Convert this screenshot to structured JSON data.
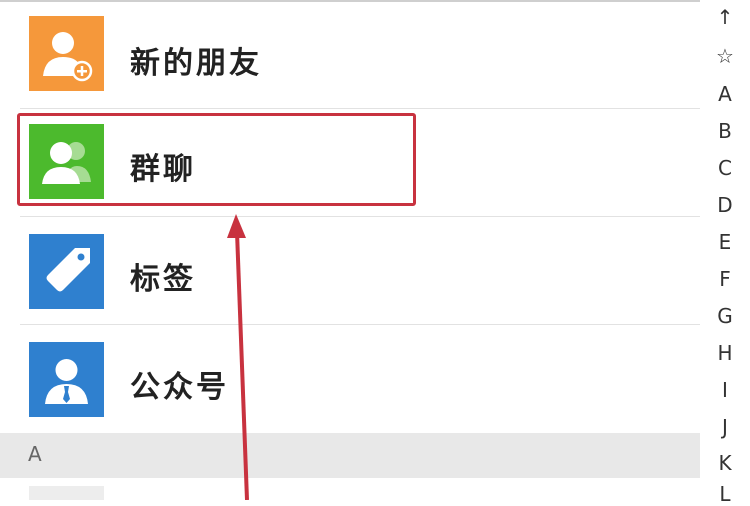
{
  "contacts": {
    "items": [
      {
        "label": "新的朋友",
        "icon": "add-friend-icon",
        "color": "#f5983b"
      },
      {
        "label": "群聊",
        "icon": "group-chat-icon",
        "color": "#4cba2d"
      },
      {
        "label": "标签",
        "icon": "tag-icon",
        "color": "#2f80cf"
      },
      {
        "label": "公众号",
        "icon": "official-account-icon",
        "color": "#2f80cf"
      }
    ],
    "section_header": "A"
  },
  "index_bar": {
    "items": [
      "↑",
      "☆",
      "A",
      "B",
      "C",
      "D",
      "E",
      "F",
      "G",
      "H",
      "I",
      "J",
      "K",
      "L"
    ]
  },
  "annotation": {
    "highlight_color": "#c8323f"
  }
}
